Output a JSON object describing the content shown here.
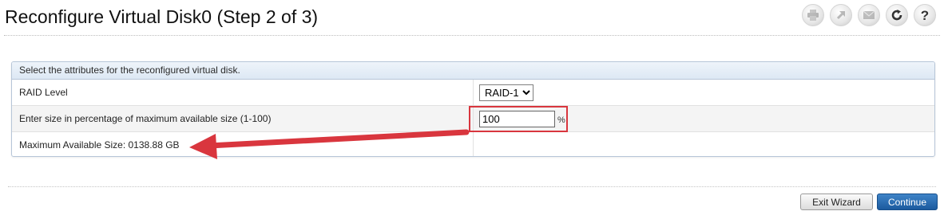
{
  "page": {
    "title": "Reconfigure Virtual Disk0 (Step 2 of 3)"
  },
  "toolbar": {
    "icons": [
      "print-icon",
      "launch-icon",
      "email-icon",
      "refresh-icon",
      "help-icon"
    ]
  },
  "panel": {
    "header": "Select the attributes for the reconfigured virtual disk.",
    "raid_label": "RAID Level",
    "raid_value": "RAID-1",
    "size_label": "Enter size in percentage of maximum available size (1-100)",
    "size_value": "100",
    "size_unit": "%",
    "max_size_label": "Maximum Available Size: 0138.88 GB"
  },
  "annotation": {
    "color": "#d9363e"
  },
  "buttons": {
    "exit": "Exit Wizard",
    "continue": "Continue"
  }
}
